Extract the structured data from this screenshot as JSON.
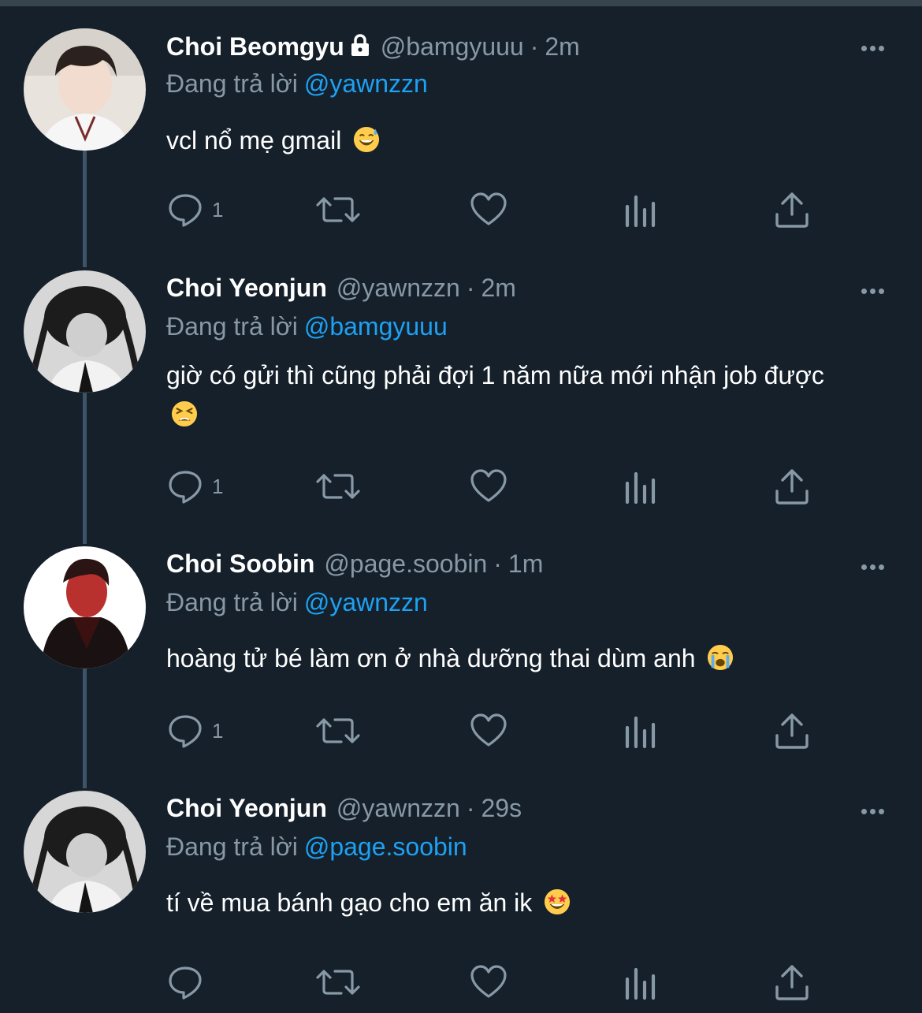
{
  "tweets": [
    {
      "name": "Choi Beomgyu",
      "locked": true,
      "handle": "@bamgyuuu",
      "dot": "·",
      "time": "2m",
      "replying_label": "Đang trả lời",
      "mention": "@yawnzzn",
      "text": "vcl nổ mẹ gmail",
      "emoji": "grinning-sweat",
      "reply_count": "1",
      "avatar_palette": "light"
    },
    {
      "name": "Choi Yeonjun",
      "locked": false,
      "handle": "@yawnzzn",
      "dot": "·",
      "time": "2m",
      "replying_label": "Đang trả lời",
      "mention": "@bamgyuuu",
      "text": "giờ có gửi thì cũng phải đợi 1 năm nữa mới nhận job được",
      "emoji": "tired-face",
      "reply_count": "1",
      "avatar_palette": "mono"
    },
    {
      "name": "Choi Soobin",
      "locked": false,
      "handle": "@page.soobin",
      "dot": "·",
      "time": "1m",
      "replying_label": "Đang trả lời",
      "mention": "@yawnzzn",
      "text": "hoàng tử bé làm ơn ở nhà dưỡng thai dùm anh",
      "emoji": "loudly-crying",
      "reply_count": "1",
      "avatar_palette": "red"
    },
    {
      "name": "Choi Yeonjun",
      "locked": false,
      "handle": "@yawnzzn",
      "dot": "·",
      "time": "29s",
      "replying_label": "Đang trả lời",
      "mention": "@page.soobin",
      "text": "tí về mua bánh gạo cho em ăn ik",
      "emoji": "star-struck",
      "reply_count": "",
      "avatar_palette": "mono"
    }
  ],
  "icons": {
    "reply": "reply-icon",
    "retweet": "retweet-icon",
    "like": "heart-icon",
    "views": "analytics-icon",
    "share": "share-icon",
    "more": "more-icon",
    "lock": "lock-icon"
  },
  "colors": {
    "background": "#15202b",
    "secondary_text": "#8899a6",
    "link": "#1da1f2",
    "thread_line": "#3d5466"
  }
}
